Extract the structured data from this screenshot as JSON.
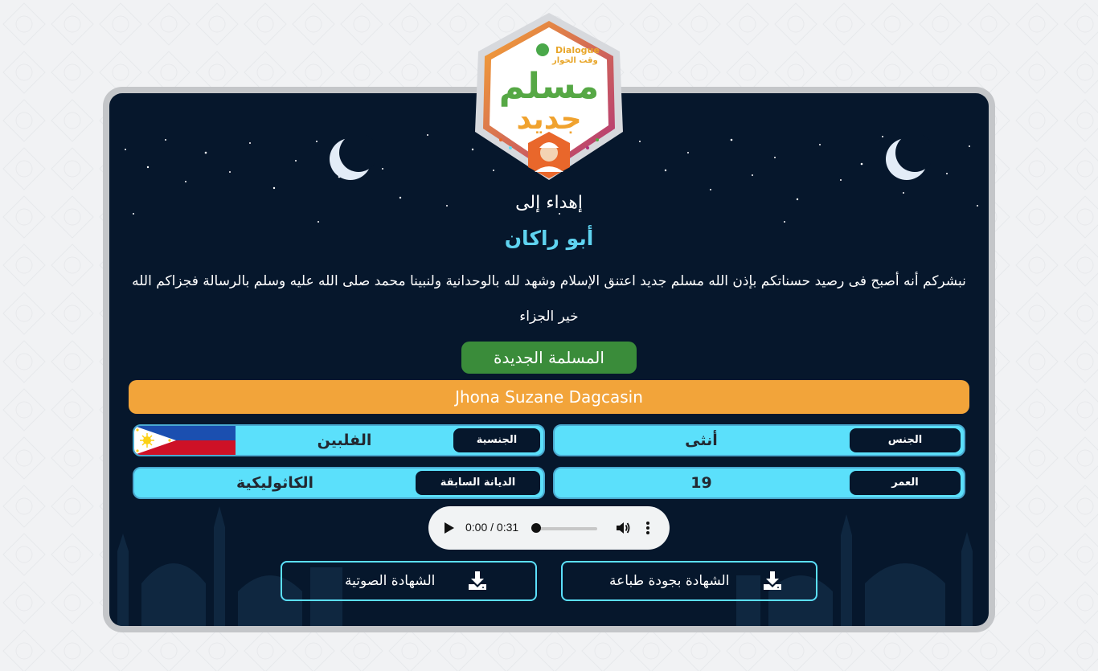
{
  "header": {
    "logo_text_1": "مسلم",
    "logo_text_2": "جديد",
    "logo_brand_en": "Dialogue",
    "logo_brand_ar": "وقت الحوار"
  },
  "certificate": {
    "dedication": "إهداء إلى",
    "recipient": "أبو راكان",
    "message": "نبشركم أنه أصبح فى رصيد حسناتكم بإذن الله مسلم جديد اعتنق الإسلام وشهد لله بالوحدانية ولنبينا محمد صلى الله عليه وسلم بالرسالة فجزاكم الله خير الجزاء",
    "section_title": "المسلمة الجديدة",
    "name": "Jhona Suzane Dagcasin"
  },
  "fields": {
    "gender_label": "الجنس",
    "gender_value": "أنثى",
    "nationality_label": "الجنسية",
    "nationality_value": "الفلبين",
    "age_label": "العمر",
    "age_value": "19",
    "prev_religion_label": "الديانة السابقة",
    "prev_religion_value": "الكاثوليكية"
  },
  "audio": {
    "time": "0:00 / 0:31",
    "progress": 0
  },
  "buttons": {
    "print_label": "الشهادة بجودة طباعة",
    "audio_label": "الشهادة الصوتية"
  },
  "colors": {
    "card_bg": "#06172c",
    "accent_cyan": "#5be0fb",
    "name_bar": "#f2a43a",
    "section_green": "#3a8c3a",
    "recipient_text": "#5fd3f0"
  },
  "icons": {
    "moon": "crescent-moon-icon",
    "download": "download-icon",
    "play": "play-icon",
    "volume": "volume-icon",
    "more": "more-vert-icon",
    "flag": "philippines-flag"
  }
}
